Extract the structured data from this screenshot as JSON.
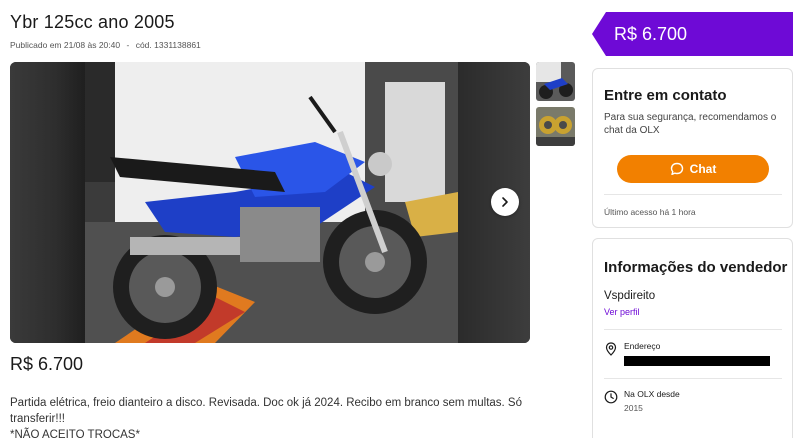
{
  "listing": {
    "title": "Ybr 125cc ano 2005",
    "published": "Publicado em 21/08 às 20:40",
    "separator": "-",
    "code": "cód. 1331138861",
    "price": "R$ 6.700",
    "description": "Partida elétrica, freio dianteiro a disco. Revisada. Doc ok já 2024. Recibo em branco sem multas. Só transferir!!!",
    "description_extra": "*NÃO ACEITO TROCAS*"
  },
  "sidebar": {
    "price_tag": "R$ 6.700",
    "contact": {
      "heading": "Entre em contato",
      "subtitle": "Para sua segurança, recomendamos o chat da OLX",
      "chat_button": "Chat",
      "last_access": "Último acesso há 1 hora"
    },
    "seller": {
      "heading": "Informações do vendedor",
      "name": "Vspdireito",
      "profile_link": "Ver perfil",
      "address_label": "Endereço",
      "since_label": "Na OLX desde",
      "since_value": "2015"
    }
  },
  "colors": {
    "brand_purple": "#6e0ad6",
    "chat_orange": "#f28000"
  },
  "icons": {
    "next": "chevron-right-icon",
    "chat": "chat-bubble-icon",
    "address": "map-pin-icon",
    "since": "clock-icon"
  }
}
